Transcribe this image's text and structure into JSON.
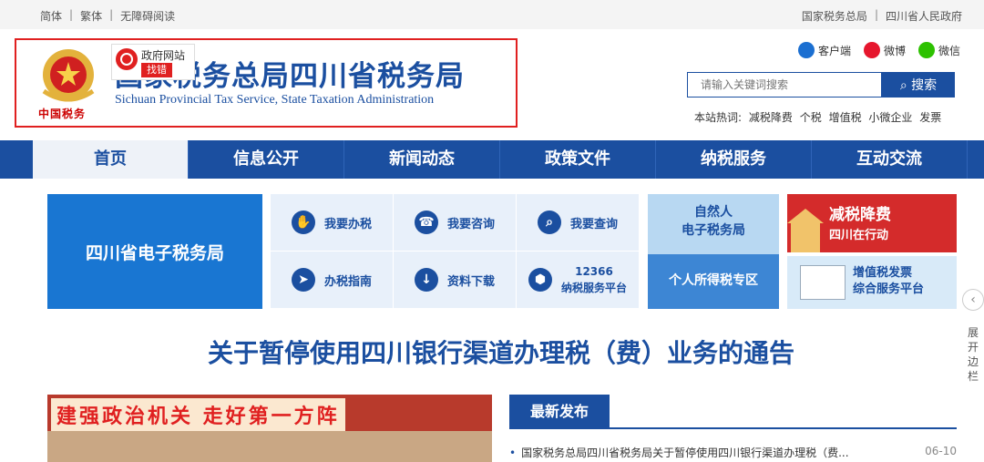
{
  "topbar": {
    "left": [
      "简体",
      "繁体",
      "无障碍阅读"
    ],
    "right": [
      "国家税务总局",
      "四川省人民政府"
    ]
  },
  "header": {
    "title_cn": "国家税务总局四川省税务局",
    "title_en": "Sichuan Provincial Tax Service, State Taxation Administration",
    "emblem_label": "中国税务",
    "gov_badge": {
      "line1": "政府网站",
      "line2": "找错"
    }
  },
  "social": [
    {
      "label": "客户端",
      "icon": "client-icon"
    },
    {
      "label": "微博",
      "icon": "weibo-icon"
    },
    {
      "label": "微信",
      "icon": "wechat-icon"
    }
  ],
  "search": {
    "placeholder": "请输入关键词搜索",
    "button": "搜索"
  },
  "hot": {
    "label": "本站热词:",
    "terms": [
      "减税降费",
      "个税",
      "增值税",
      "小微企业",
      "发票"
    ]
  },
  "nav": [
    {
      "label": "首页",
      "active": true
    },
    {
      "label": "信息公开",
      "active": false
    },
    {
      "label": "新闻动态",
      "active": false
    },
    {
      "label": "政策文件",
      "active": false
    },
    {
      "label": "纳税服务",
      "active": false
    },
    {
      "label": "互动交流",
      "active": false
    }
  ],
  "etax": {
    "label": "四川省电子税务局"
  },
  "services": [
    {
      "label": "我要办税",
      "icon": "hand-icon"
    },
    {
      "label": "我要咨询",
      "icon": "headset-icon"
    },
    {
      "label": "我要查询",
      "icon": "search-doc-icon"
    },
    {
      "label": "办税指南",
      "icon": "compass-icon"
    },
    {
      "label": "资料下载",
      "icon": "download-icon"
    },
    {
      "label1": "12366",
      "label2": "纳税服务平台",
      "icon": "platform-icon"
    }
  ],
  "natural_person": {
    "line1": "自然人",
    "line2": "电子税务局",
    "band": "个人所得税专区"
  },
  "reduce": {
    "line1": "减税降费",
    "line2": "四川在行动"
  },
  "vat": {
    "line1": "增值税发票",
    "line2": "综合服务平台"
  },
  "side": {
    "label": "展开边栏"
  },
  "notice": {
    "title": "关于暂停使用四川银行渠道办理税（费）业务的通告"
  },
  "banner": {
    "text": "建强政治机关 走好第一方阵"
  },
  "latest": {
    "tab": "最新发布",
    "items": [
      {
        "title": "国家税务总局四川省税务局关于暂停使用四川银行渠道办理税（费...",
        "date": "06-10"
      }
    ]
  }
}
